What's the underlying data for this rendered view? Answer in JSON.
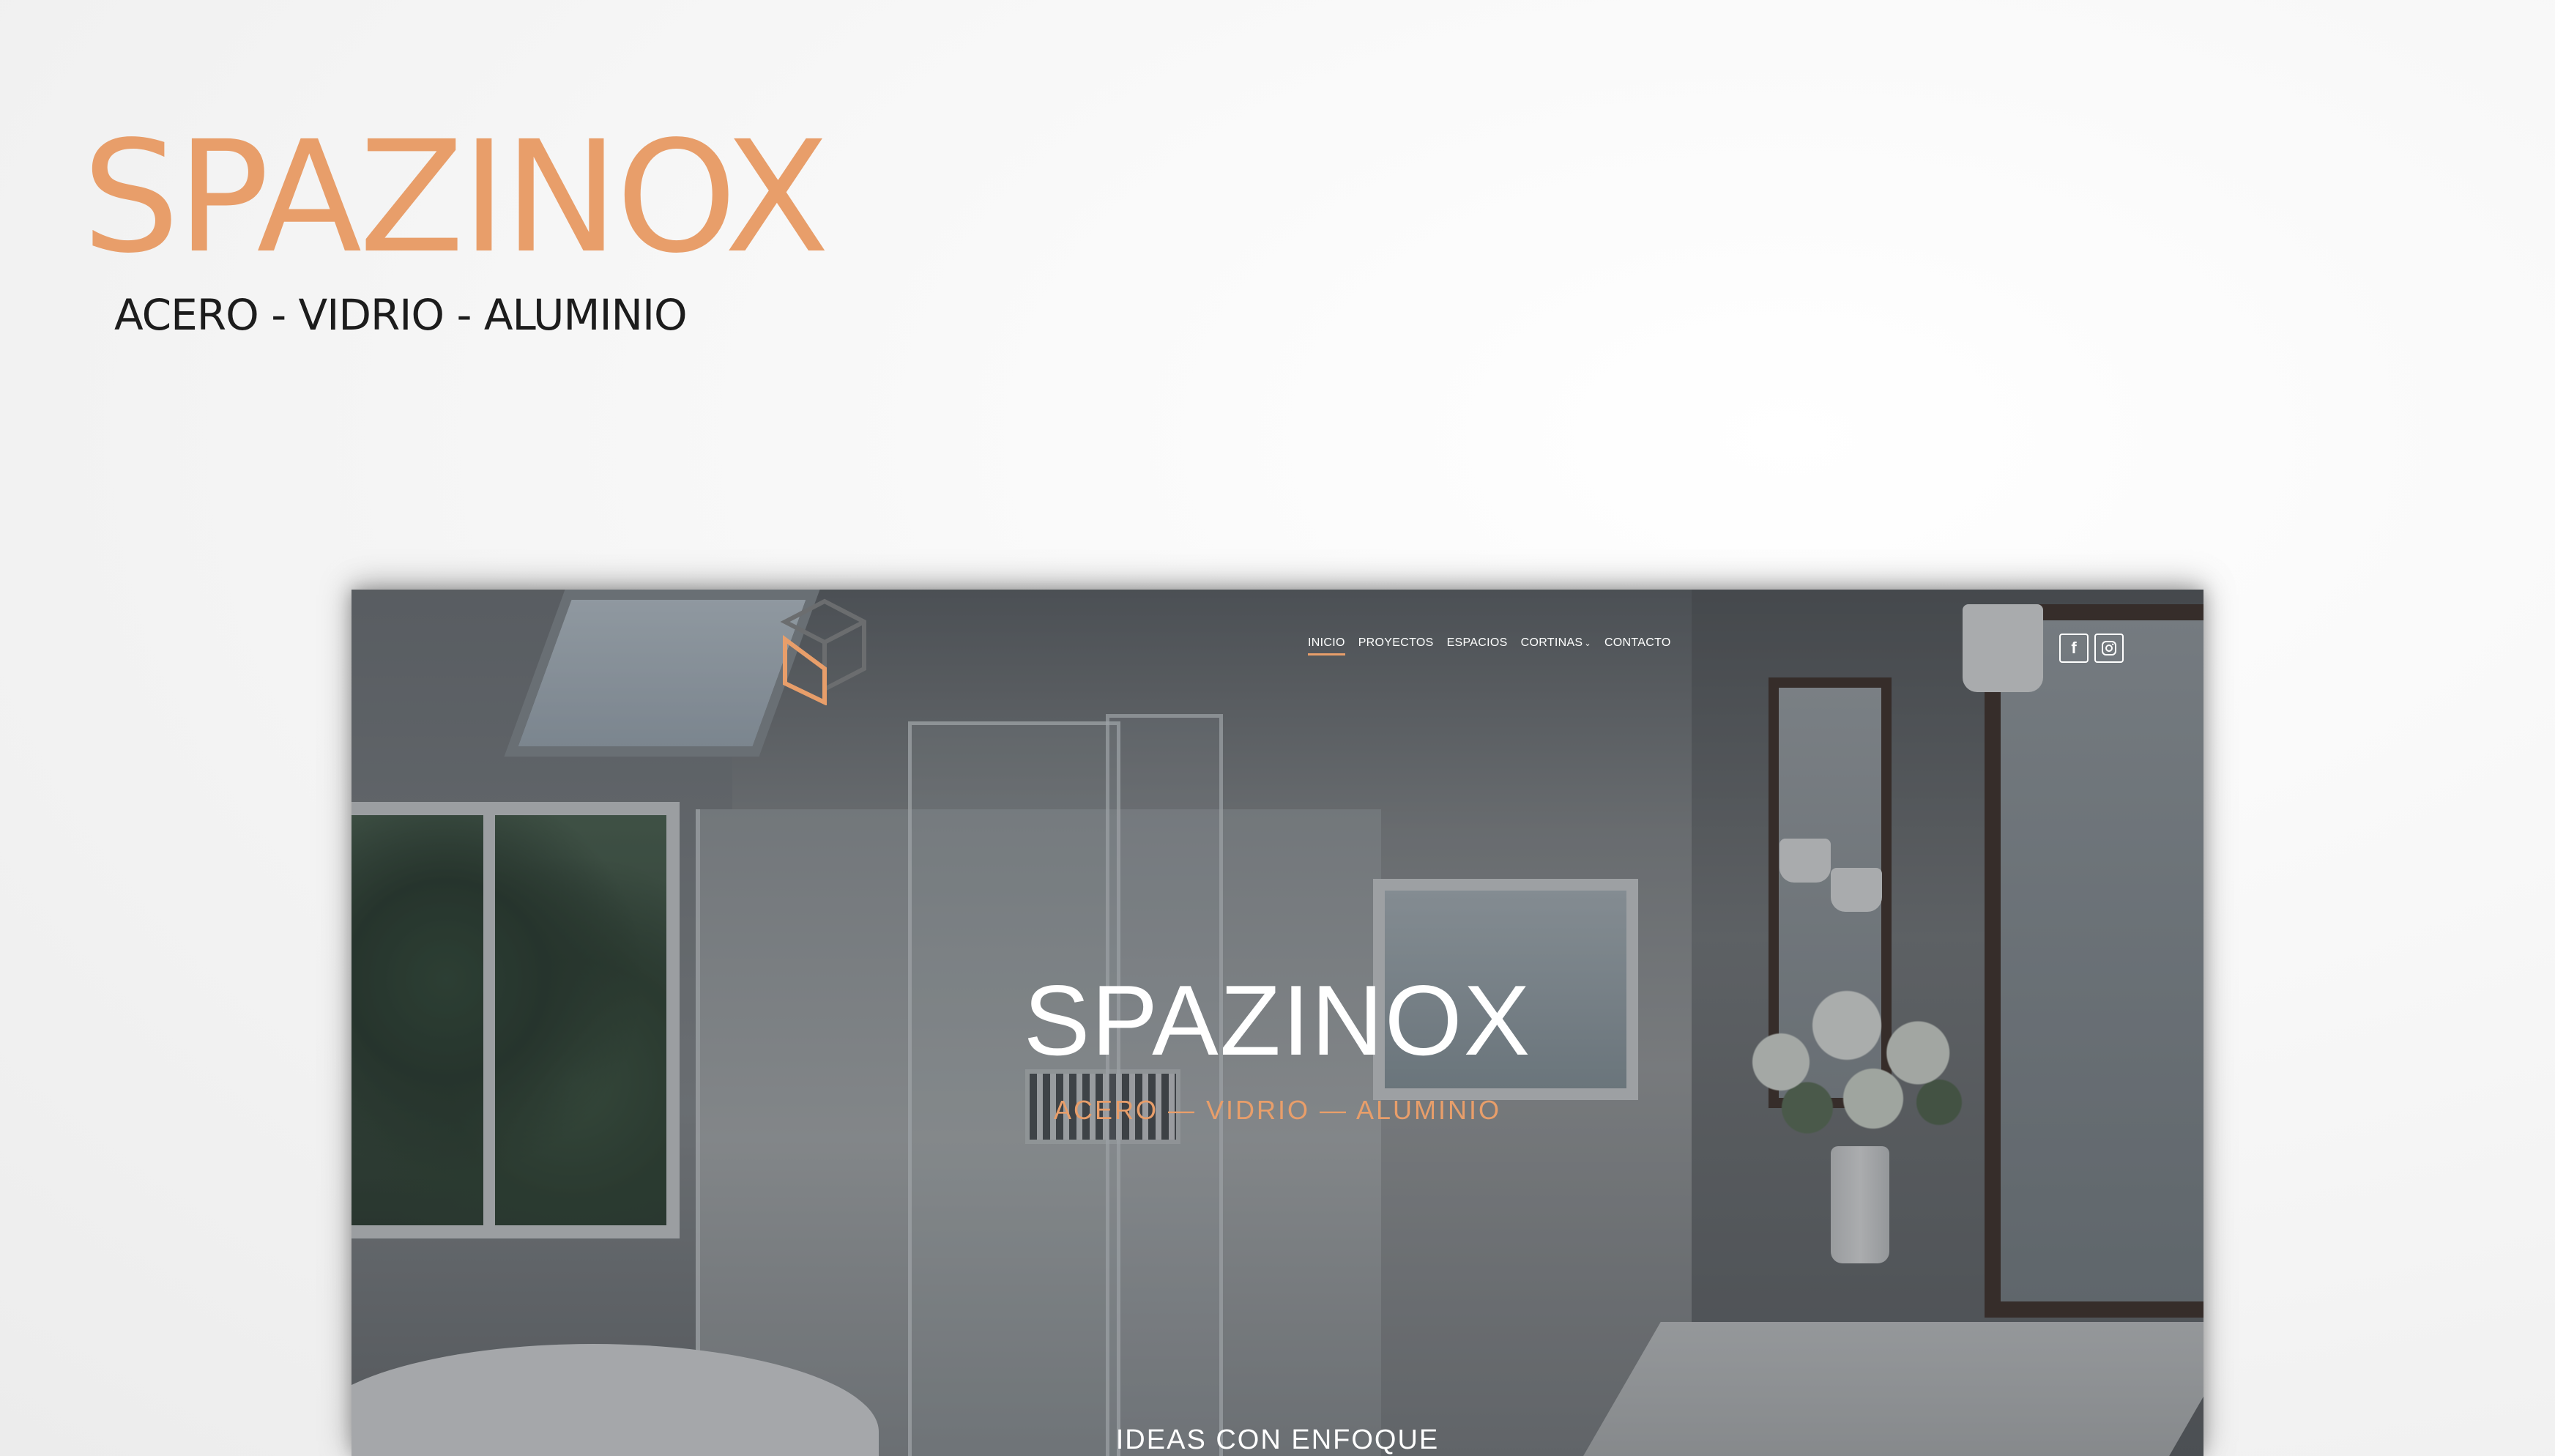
{
  "brand": {
    "title": "SPAZINOX",
    "tagline": "ACERO - VIDRIO - ALUMINIO"
  },
  "site": {
    "nav": {
      "items": [
        {
          "label": "INICIO",
          "active": true
        },
        {
          "label": "PROYECTOS",
          "active": false
        },
        {
          "label": "ESPACIOS",
          "active": false
        },
        {
          "label": "CORTINAS",
          "active": false,
          "has_dropdown": true
        },
        {
          "label": "CONTACTO",
          "active": false
        }
      ]
    },
    "social": {
      "facebook_glyph": "f",
      "instagram_icon": "instagram-icon"
    },
    "hero": {
      "title": "SPAZINOX",
      "subtitle": "ACERO — VIDRIO — ALUMINIO",
      "bottom_heading": "IDEAS CON ENFOQUE"
    }
  },
  "colors": {
    "accent": "#e89e6a",
    "tagline": "#1c1c1c",
    "nav_text": "#ffffff",
    "hero_text": "#ffffff"
  }
}
